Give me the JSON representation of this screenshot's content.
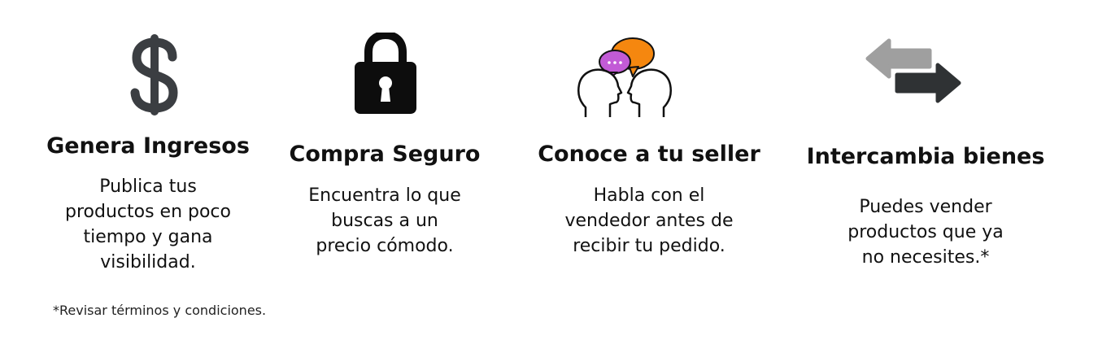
{
  "colors": {
    "text": "#111111",
    "dollar": "#3b3e42",
    "lock": "#0d0d0d",
    "bubble_purple": "#c25bd6",
    "bubble_orange": "#f5870f",
    "arrow_light": "#9f9f9f",
    "arrow_dark": "#2f3234"
  },
  "features": [
    {
      "icon": "dollar-icon",
      "title": "Genera Ingresos",
      "description_lines": [
        "Publica tus",
        "productos en poco",
        "tiempo y gana",
        "visibilidad."
      ]
    },
    {
      "icon": "lock-icon",
      "title": "Compra Seguro",
      "description_lines": [
        "Encuentra lo que",
        "buscas a un",
        "precio cómodo."
      ]
    },
    {
      "icon": "conversation-icon",
      "title": "Conoce a tu seller",
      "description_lines": [
        "Habla con el",
        "vendedor antes de",
        "recibir tu pedido."
      ]
    },
    {
      "icon": "exchange-arrows-icon",
      "title": "Intercambia bienes",
      "description_lines": [
        "Puedes vender",
        "productos que ya",
        "no necesites.*"
      ]
    }
  ],
  "footnote": "*Revisar términos y condiciones."
}
